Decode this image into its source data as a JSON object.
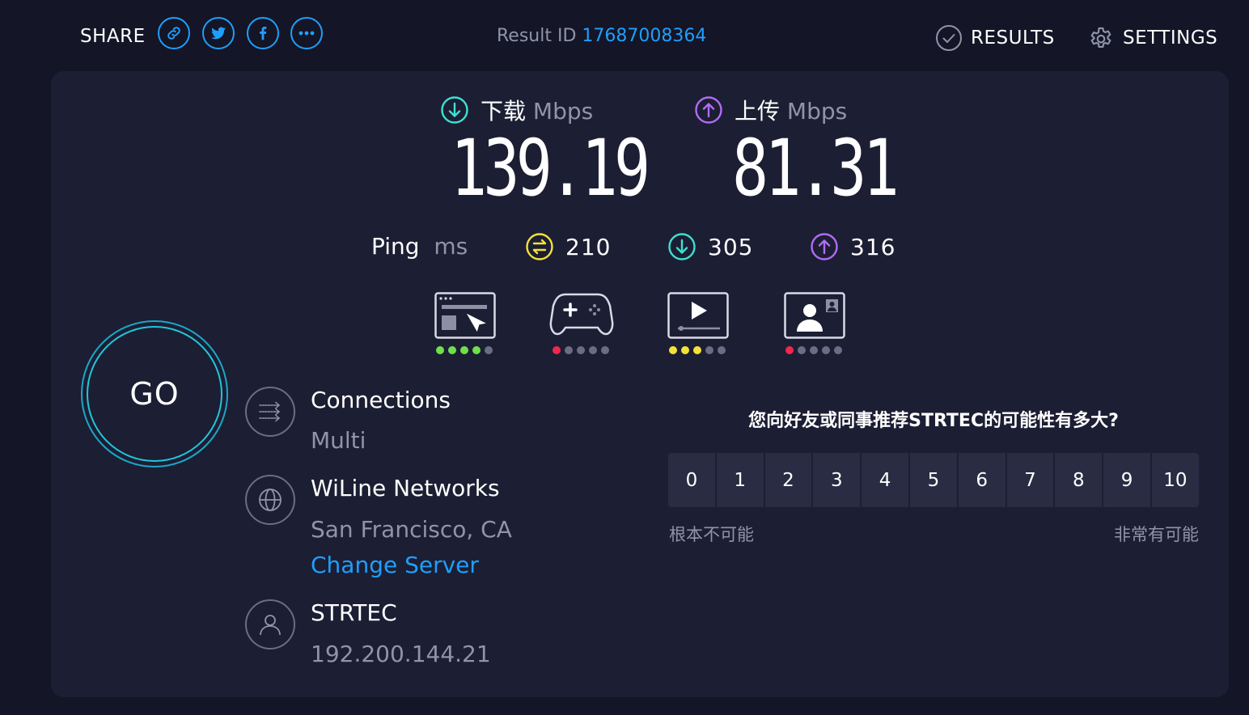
{
  "header": {
    "share_label": "SHARE",
    "share_buttons": [
      "link-icon",
      "twitter-icon",
      "facebook-icon",
      "more-icon"
    ],
    "result_id_label": "Result ID",
    "result_id_value": "17687008364",
    "results_label": "RESULTS",
    "settings_label": "SETTINGS"
  },
  "download": {
    "label": "下载",
    "unit": "Mbps",
    "value": "139.19"
  },
  "upload": {
    "label": "上传",
    "unit": "Mbps",
    "value": "81.31"
  },
  "ping": {
    "label": "Ping",
    "unit": "ms",
    "idle": "210",
    "download": "305",
    "upload": "316"
  },
  "quality": [
    {
      "icon": "web-browsing-icon",
      "rating": 4,
      "color": "#6ee04a"
    },
    {
      "icon": "gaming-icon",
      "rating": 1,
      "color": "#f0284e"
    },
    {
      "icon": "video-streaming-icon",
      "rating": 3,
      "color": "#f4e23a"
    },
    {
      "icon": "video-call-icon",
      "rating": 1,
      "color": "#f0284e"
    }
  ],
  "go_label": "GO",
  "connections": {
    "title": "Connections",
    "value": "Multi"
  },
  "server": {
    "name": "WiLine Networks",
    "location": "San Francisco, CA",
    "change_label": "Change Server"
  },
  "client": {
    "name": "STRTEC",
    "ip": "192.200.144.21"
  },
  "survey": {
    "question": "您向好友或同事推荐STRTEC的可能性有多大?",
    "options": [
      "0",
      "1",
      "2",
      "3",
      "4",
      "5",
      "6",
      "7",
      "8",
      "9",
      "10"
    ],
    "low_label": "根本不可能",
    "high_label": "非常有可能"
  },
  "colors": {
    "accent": "#1f9ffc",
    "download": "#3ee0d0",
    "upload": "#b06cf5",
    "ping_idle": "#f4e23a"
  }
}
